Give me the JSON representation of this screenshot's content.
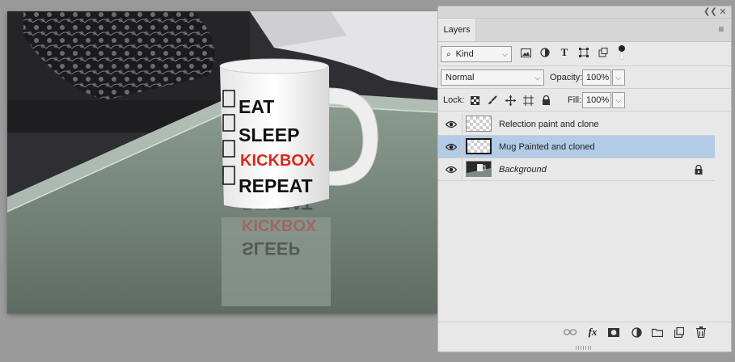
{
  "canvas": {
    "mug_lines": [
      "EAT",
      "SLEEP",
      "KICKBOX",
      "REPEAT"
    ]
  },
  "panel": {
    "tab_label": "Layers",
    "collapse_icon": "double-chevron-left-icon",
    "close_icon": "close-icon",
    "menu_icon": "hamburger-menu-icon",
    "filter": {
      "kind_label": "Kind",
      "icons": [
        "image-filter-icon",
        "adjustment-filter-icon",
        "type-filter-icon",
        "shape-filter-icon",
        "smart-object-filter-icon",
        "filter-toggle-icon"
      ]
    },
    "blend": {
      "mode": "Normal",
      "opacity_label": "Opacity:",
      "opacity_value": "100%"
    },
    "lock": {
      "label": "Lock:",
      "icons": [
        "lock-transparent-icon",
        "lock-image-icon",
        "lock-position-icon",
        "lock-artboard-icon",
        "lock-all-icon"
      ],
      "fill_label": "Fill:",
      "fill_value": "100%"
    },
    "layers": [
      {
        "name": "Relection paint and clone",
        "selected": false,
        "background": false
      },
      {
        "name": "Mug Painted and cloned",
        "selected": true,
        "background": false
      },
      {
        "name": "Background",
        "selected": false,
        "background": true
      }
    ],
    "bottom_icons": [
      "link-layers-icon",
      "fx-icon",
      "mask-icon",
      "adjustment-layer-icon",
      "folder-icon",
      "new-layer-icon",
      "trash-icon"
    ],
    "fx_label": "fx"
  },
  "colors": {
    "selected_row": "#b2cbe6",
    "kickbox_red": "#d8281e",
    "panel_bg": "#e8e8e8"
  }
}
